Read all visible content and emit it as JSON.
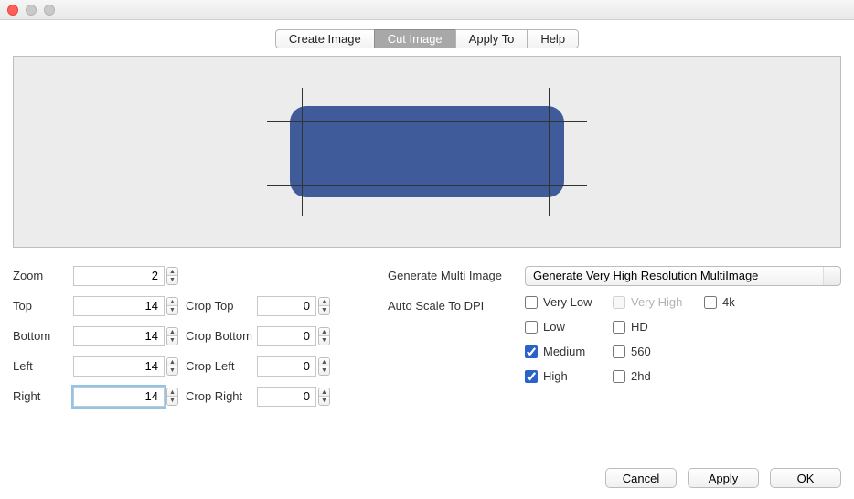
{
  "tabs": {
    "create": "Create Image",
    "cut": "Cut Image",
    "apply": "Apply To",
    "help": "Help",
    "active": "cut"
  },
  "left": {
    "zoom_label": "Zoom",
    "zoom_value": "2",
    "top_label": "Top",
    "top_value": "14",
    "bottom_label": "Bottom",
    "bottom_value": "14",
    "left_label": "Left",
    "left_value": "14",
    "right_label": "Right",
    "right_value": "14",
    "crop_top_label": "Crop Top",
    "crop_top_value": "0",
    "crop_bottom_label": "Crop Bottom",
    "crop_bottom_value": "0",
    "crop_left_label": "Crop Left",
    "crop_left_value": "0",
    "crop_right_label": "Crop Right",
    "crop_right_value": "0"
  },
  "right": {
    "gen_label": "Generate Multi Image",
    "gen_selected": "Generate Very High Resolution MultiImage",
    "auto_label": "Auto Scale To DPI",
    "cb": {
      "very_low": "Very Low",
      "low": "Low",
      "medium": "Medium",
      "high": "High",
      "very_high": "Very High",
      "hd": "HD",
      "r560": "560",
      "r2hd": "2hd",
      "r4k": "4k"
    },
    "checked": {
      "medium": true,
      "high": true
    }
  },
  "footer": {
    "cancel": "Cancel",
    "apply": "Apply",
    "ok": "OK"
  }
}
